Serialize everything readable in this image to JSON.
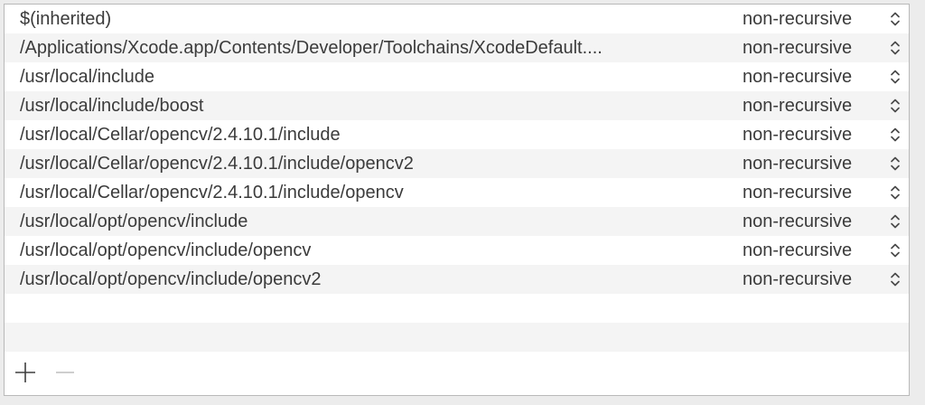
{
  "search_paths": {
    "rows": [
      {
        "path": "$(inherited)",
        "mode": "non-recursive"
      },
      {
        "path": "/Applications/Xcode.app/Contents/Developer/Toolchains/XcodeDefault....",
        "mode": "non-recursive"
      },
      {
        "path": "/usr/local/include",
        "mode": "non-recursive"
      },
      {
        "path": "/usr/local/include/boost",
        "mode": "non-recursive"
      },
      {
        "path": "/usr/local/Cellar/opencv/2.4.10.1/include",
        "mode": "non-recursive"
      },
      {
        "path": "/usr/local/Cellar/opencv/2.4.10.1/include/opencv2",
        "mode": "non-recursive"
      },
      {
        "path": "/usr/local/Cellar/opencv/2.4.10.1/include/opencv",
        "mode": "non-recursive"
      },
      {
        "path": "/usr/local/opt/opencv/include",
        "mode": "non-recursive"
      },
      {
        "path": "/usr/local/opt/opencv/include/opencv",
        "mode": "non-recursive"
      },
      {
        "path": "/usr/local/opt/opencv/include/opencv2",
        "mode": "non-recursive"
      }
    ]
  },
  "toolbar": {
    "add_icon": "plus-icon",
    "remove_icon": "minus-icon"
  },
  "colors": {
    "row_alt": "#f4f4f4",
    "text": "#3b3b3b",
    "border": "#b9b9b9"
  }
}
